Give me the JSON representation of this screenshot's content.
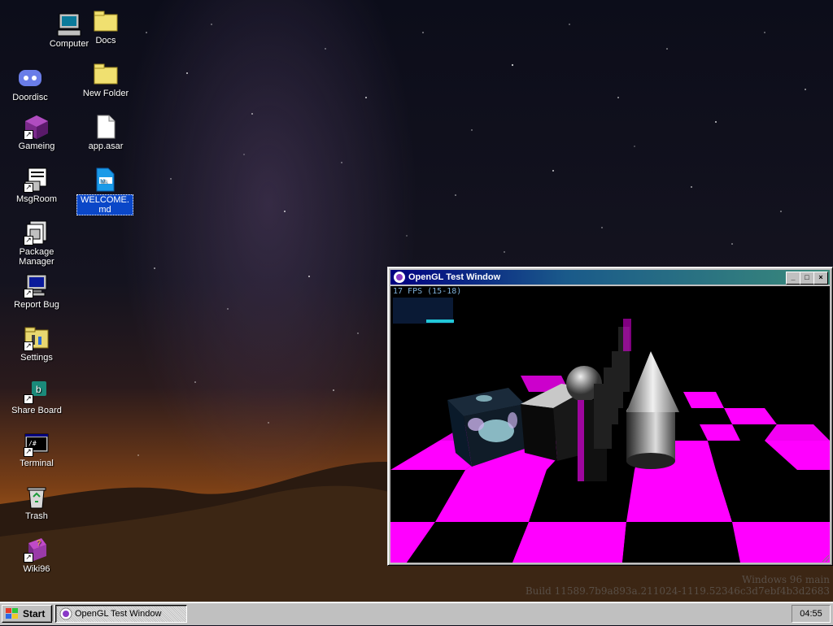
{
  "desktop": {
    "icons": [
      {
        "label": "Computer",
        "icon": "computer-icon"
      },
      {
        "label": "Docs",
        "icon": "folder-icon"
      },
      {
        "label": "Doordisc",
        "icon": "discord-icon"
      },
      {
        "label": "New Folder",
        "icon": "folder-icon"
      },
      {
        "label": "Gameing",
        "icon": "cube-icon"
      },
      {
        "label": "app.asar",
        "icon": "file-icon"
      },
      {
        "label": "MsgRoom",
        "icon": "chat-icon"
      },
      {
        "label": "WELCOME.md",
        "icon": "markdown-file-icon"
      },
      {
        "label": "Package Manager",
        "icon": "package-icon"
      },
      {
        "label": "Report Bug",
        "icon": "monitor-icon"
      },
      {
        "label": "Settings",
        "icon": "settings-folder-icon"
      },
      {
        "label": "Share Board",
        "icon": "share-icon"
      },
      {
        "label": "Terminal",
        "icon": "terminal-icon"
      },
      {
        "label": "Trash",
        "icon": "trash-icon"
      },
      {
        "label": "Wiki96",
        "icon": "book-icon"
      }
    ]
  },
  "window": {
    "title": "OpenGL Test Window",
    "fps_text": "17 FPS (15-18)",
    "minimize_label": "_",
    "maximize_label": "□",
    "close_label": "×"
  },
  "watermark": {
    "line1": "Windows 96 main",
    "line2": "Build 11589.7b9a893a.211024-1119.52346c3d7ebf4b3d2683"
  },
  "taskbar": {
    "start_label": "Start",
    "task_label": "OpenGL Test Window",
    "clock": "04:55"
  },
  "colors": {
    "checker_magenta": "#ff00ff",
    "title_start": "#000080",
    "title_end": "#3a8a7a",
    "selection": "#0a47c8"
  }
}
